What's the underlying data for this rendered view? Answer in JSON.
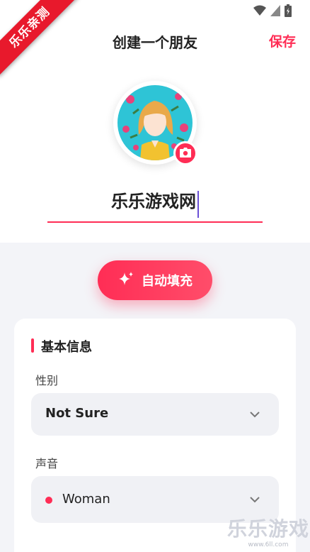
{
  "header": {
    "title": "创建一个朋友",
    "save_label": "保存"
  },
  "ribbon": "乐乐亲测",
  "profile": {
    "name": "乐乐游戏网"
  },
  "autofill": {
    "label": "自动填充"
  },
  "basic_info": {
    "title": "基本信息",
    "gender": {
      "label": "性别",
      "value": "Not Sure"
    },
    "voice": {
      "label": "声音",
      "value": "Woman"
    }
  },
  "watermark": {
    "title": "乐乐游戏",
    "url": "www.6ll.com"
  },
  "colors": {
    "accent": "#ff2d55",
    "background": "#f3f4f8",
    "field_bg": "#f0f1f5"
  },
  "icons": [
    "back-arrow-icon",
    "camera-icon",
    "sparkle-icon",
    "chevron-down-icon",
    "wifi-icon",
    "signal-icon",
    "battery-icon"
  ]
}
